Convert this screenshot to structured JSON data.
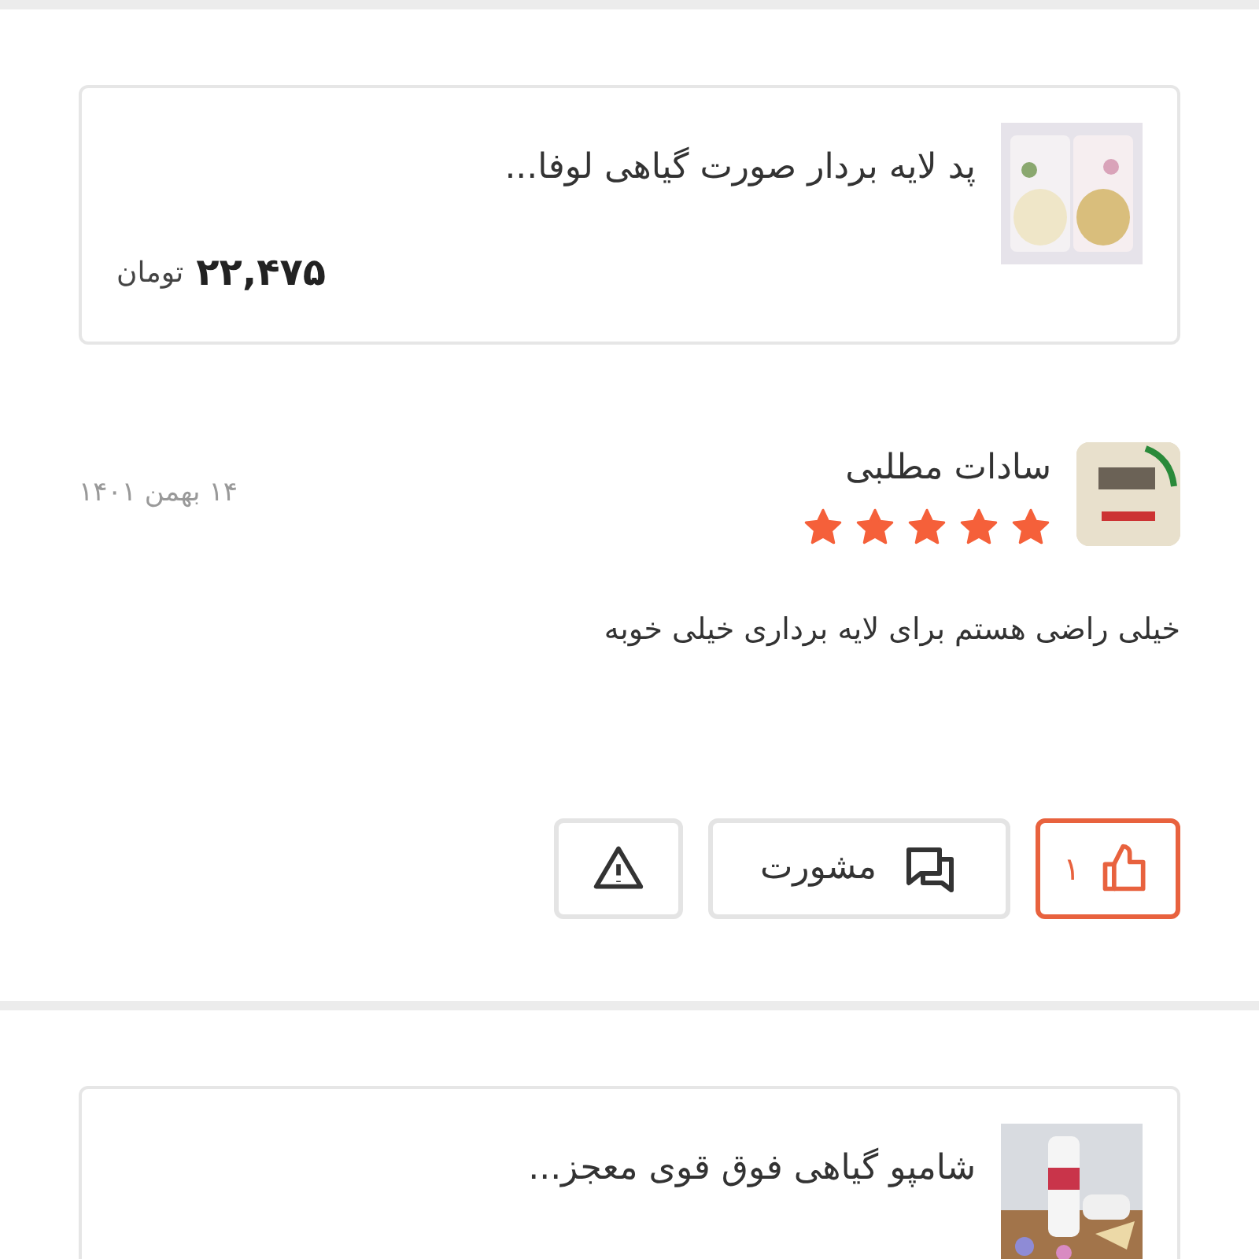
{
  "reviews": [
    {
      "product": {
        "title": "پد لایه بردار صورت گیاهی لوفا...",
        "price": "۲۲,۴۷۵",
        "currency": "تومان"
      },
      "author": "سادات مطلبی",
      "stars": 5,
      "date": "۱۴ بهمن ۱۴۰۱",
      "comment": "خیلی راضی هستم برای لایه برداری خیلی خوبه",
      "like": {
        "count": "۱",
        "selected": true
      },
      "consult": "مشورت"
    },
    {
      "product": {
        "title": "شامپو گیاهی فوق قوی معجز..."
      }
    }
  ]
}
